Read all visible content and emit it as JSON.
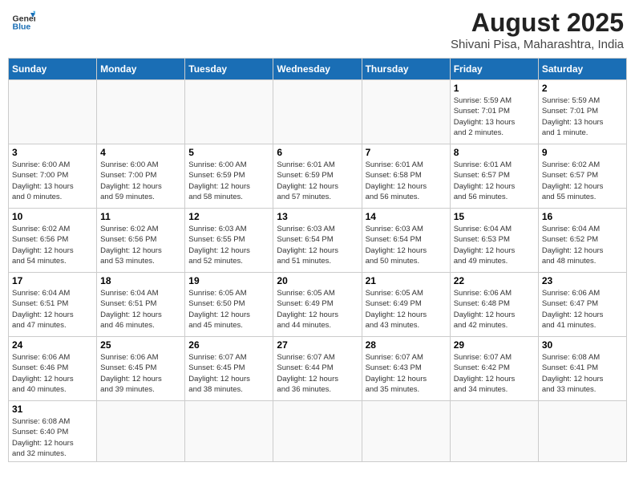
{
  "header": {
    "logo_general": "General",
    "logo_blue": "Blue",
    "month_year": "August 2025",
    "subtitle": "Shivani Pisa, Maharashtra, India"
  },
  "days_of_week": [
    "Sunday",
    "Monday",
    "Tuesday",
    "Wednesday",
    "Thursday",
    "Friday",
    "Saturday"
  ],
  "weeks": [
    [
      {
        "day": "",
        "info": ""
      },
      {
        "day": "",
        "info": ""
      },
      {
        "day": "",
        "info": ""
      },
      {
        "day": "",
        "info": ""
      },
      {
        "day": "",
        "info": ""
      },
      {
        "day": "1",
        "info": "Sunrise: 5:59 AM\nSunset: 7:01 PM\nDaylight: 13 hours\nand 2 minutes."
      },
      {
        "day": "2",
        "info": "Sunrise: 5:59 AM\nSunset: 7:01 PM\nDaylight: 13 hours\nand 1 minute."
      }
    ],
    [
      {
        "day": "3",
        "info": "Sunrise: 6:00 AM\nSunset: 7:00 PM\nDaylight: 13 hours\nand 0 minutes."
      },
      {
        "day": "4",
        "info": "Sunrise: 6:00 AM\nSunset: 7:00 PM\nDaylight: 12 hours\nand 59 minutes."
      },
      {
        "day": "5",
        "info": "Sunrise: 6:00 AM\nSunset: 6:59 PM\nDaylight: 12 hours\nand 58 minutes."
      },
      {
        "day": "6",
        "info": "Sunrise: 6:01 AM\nSunset: 6:59 PM\nDaylight: 12 hours\nand 57 minutes."
      },
      {
        "day": "7",
        "info": "Sunrise: 6:01 AM\nSunset: 6:58 PM\nDaylight: 12 hours\nand 56 minutes."
      },
      {
        "day": "8",
        "info": "Sunrise: 6:01 AM\nSunset: 6:57 PM\nDaylight: 12 hours\nand 56 minutes."
      },
      {
        "day": "9",
        "info": "Sunrise: 6:02 AM\nSunset: 6:57 PM\nDaylight: 12 hours\nand 55 minutes."
      }
    ],
    [
      {
        "day": "10",
        "info": "Sunrise: 6:02 AM\nSunset: 6:56 PM\nDaylight: 12 hours\nand 54 minutes."
      },
      {
        "day": "11",
        "info": "Sunrise: 6:02 AM\nSunset: 6:56 PM\nDaylight: 12 hours\nand 53 minutes."
      },
      {
        "day": "12",
        "info": "Sunrise: 6:03 AM\nSunset: 6:55 PM\nDaylight: 12 hours\nand 52 minutes."
      },
      {
        "day": "13",
        "info": "Sunrise: 6:03 AM\nSunset: 6:54 PM\nDaylight: 12 hours\nand 51 minutes."
      },
      {
        "day": "14",
        "info": "Sunrise: 6:03 AM\nSunset: 6:54 PM\nDaylight: 12 hours\nand 50 minutes."
      },
      {
        "day": "15",
        "info": "Sunrise: 6:04 AM\nSunset: 6:53 PM\nDaylight: 12 hours\nand 49 minutes."
      },
      {
        "day": "16",
        "info": "Sunrise: 6:04 AM\nSunset: 6:52 PM\nDaylight: 12 hours\nand 48 minutes."
      }
    ],
    [
      {
        "day": "17",
        "info": "Sunrise: 6:04 AM\nSunset: 6:51 PM\nDaylight: 12 hours\nand 47 minutes."
      },
      {
        "day": "18",
        "info": "Sunrise: 6:04 AM\nSunset: 6:51 PM\nDaylight: 12 hours\nand 46 minutes."
      },
      {
        "day": "19",
        "info": "Sunrise: 6:05 AM\nSunset: 6:50 PM\nDaylight: 12 hours\nand 45 minutes."
      },
      {
        "day": "20",
        "info": "Sunrise: 6:05 AM\nSunset: 6:49 PM\nDaylight: 12 hours\nand 44 minutes."
      },
      {
        "day": "21",
        "info": "Sunrise: 6:05 AM\nSunset: 6:49 PM\nDaylight: 12 hours\nand 43 minutes."
      },
      {
        "day": "22",
        "info": "Sunrise: 6:06 AM\nSunset: 6:48 PM\nDaylight: 12 hours\nand 42 minutes."
      },
      {
        "day": "23",
        "info": "Sunrise: 6:06 AM\nSunset: 6:47 PM\nDaylight: 12 hours\nand 41 minutes."
      }
    ],
    [
      {
        "day": "24",
        "info": "Sunrise: 6:06 AM\nSunset: 6:46 PM\nDaylight: 12 hours\nand 40 minutes."
      },
      {
        "day": "25",
        "info": "Sunrise: 6:06 AM\nSunset: 6:45 PM\nDaylight: 12 hours\nand 39 minutes."
      },
      {
        "day": "26",
        "info": "Sunrise: 6:07 AM\nSunset: 6:45 PM\nDaylight: 12 hours\nand 38 minutes."
      },
      {
        "day": "27",
        "info": "Sunrise: 6:07 AM\nSunset: 6:44 PM\nDaylight: 12 hours\nand 36 minutes."
      },
      {
        "day": "28",
        "info": "Sunrise: 6:07 AM\nSunset: 6:43 PM\nDaylight: 12 hours\nand 35 minutes."
      },
      {
        "day": "29",
        "info": "Sunrise: 6:07 AM\nSunset: 6:42 PM\nDaylight: 12 hours\nand 34 minutes."
      },
      {
        "day": "30",
        "info": "Sunrise: 6:08 AM\nSunset: 6:41 PM\nDaylight: 12 hours\nand 33 minutes."
      }
    ],
    [
      {
        "day": "31",
        "info": "Sunrise: 6:08 AM\nSunset: 6:40 PM\nDaylight: 12 hours\nand 32 minutes."
      },
      {
        "day": "",
        "info": ""
      },
      {
        "day": "",
        "info": ""
      },
      {
        "day": "",
        "info": ""
      },
      {
        "day": "",
        "info": ""
      },
      {
        "day": "",
        "info": ""
      },
      {
        "day": "",
        "info": ""
      }
    ]
  ]
}
